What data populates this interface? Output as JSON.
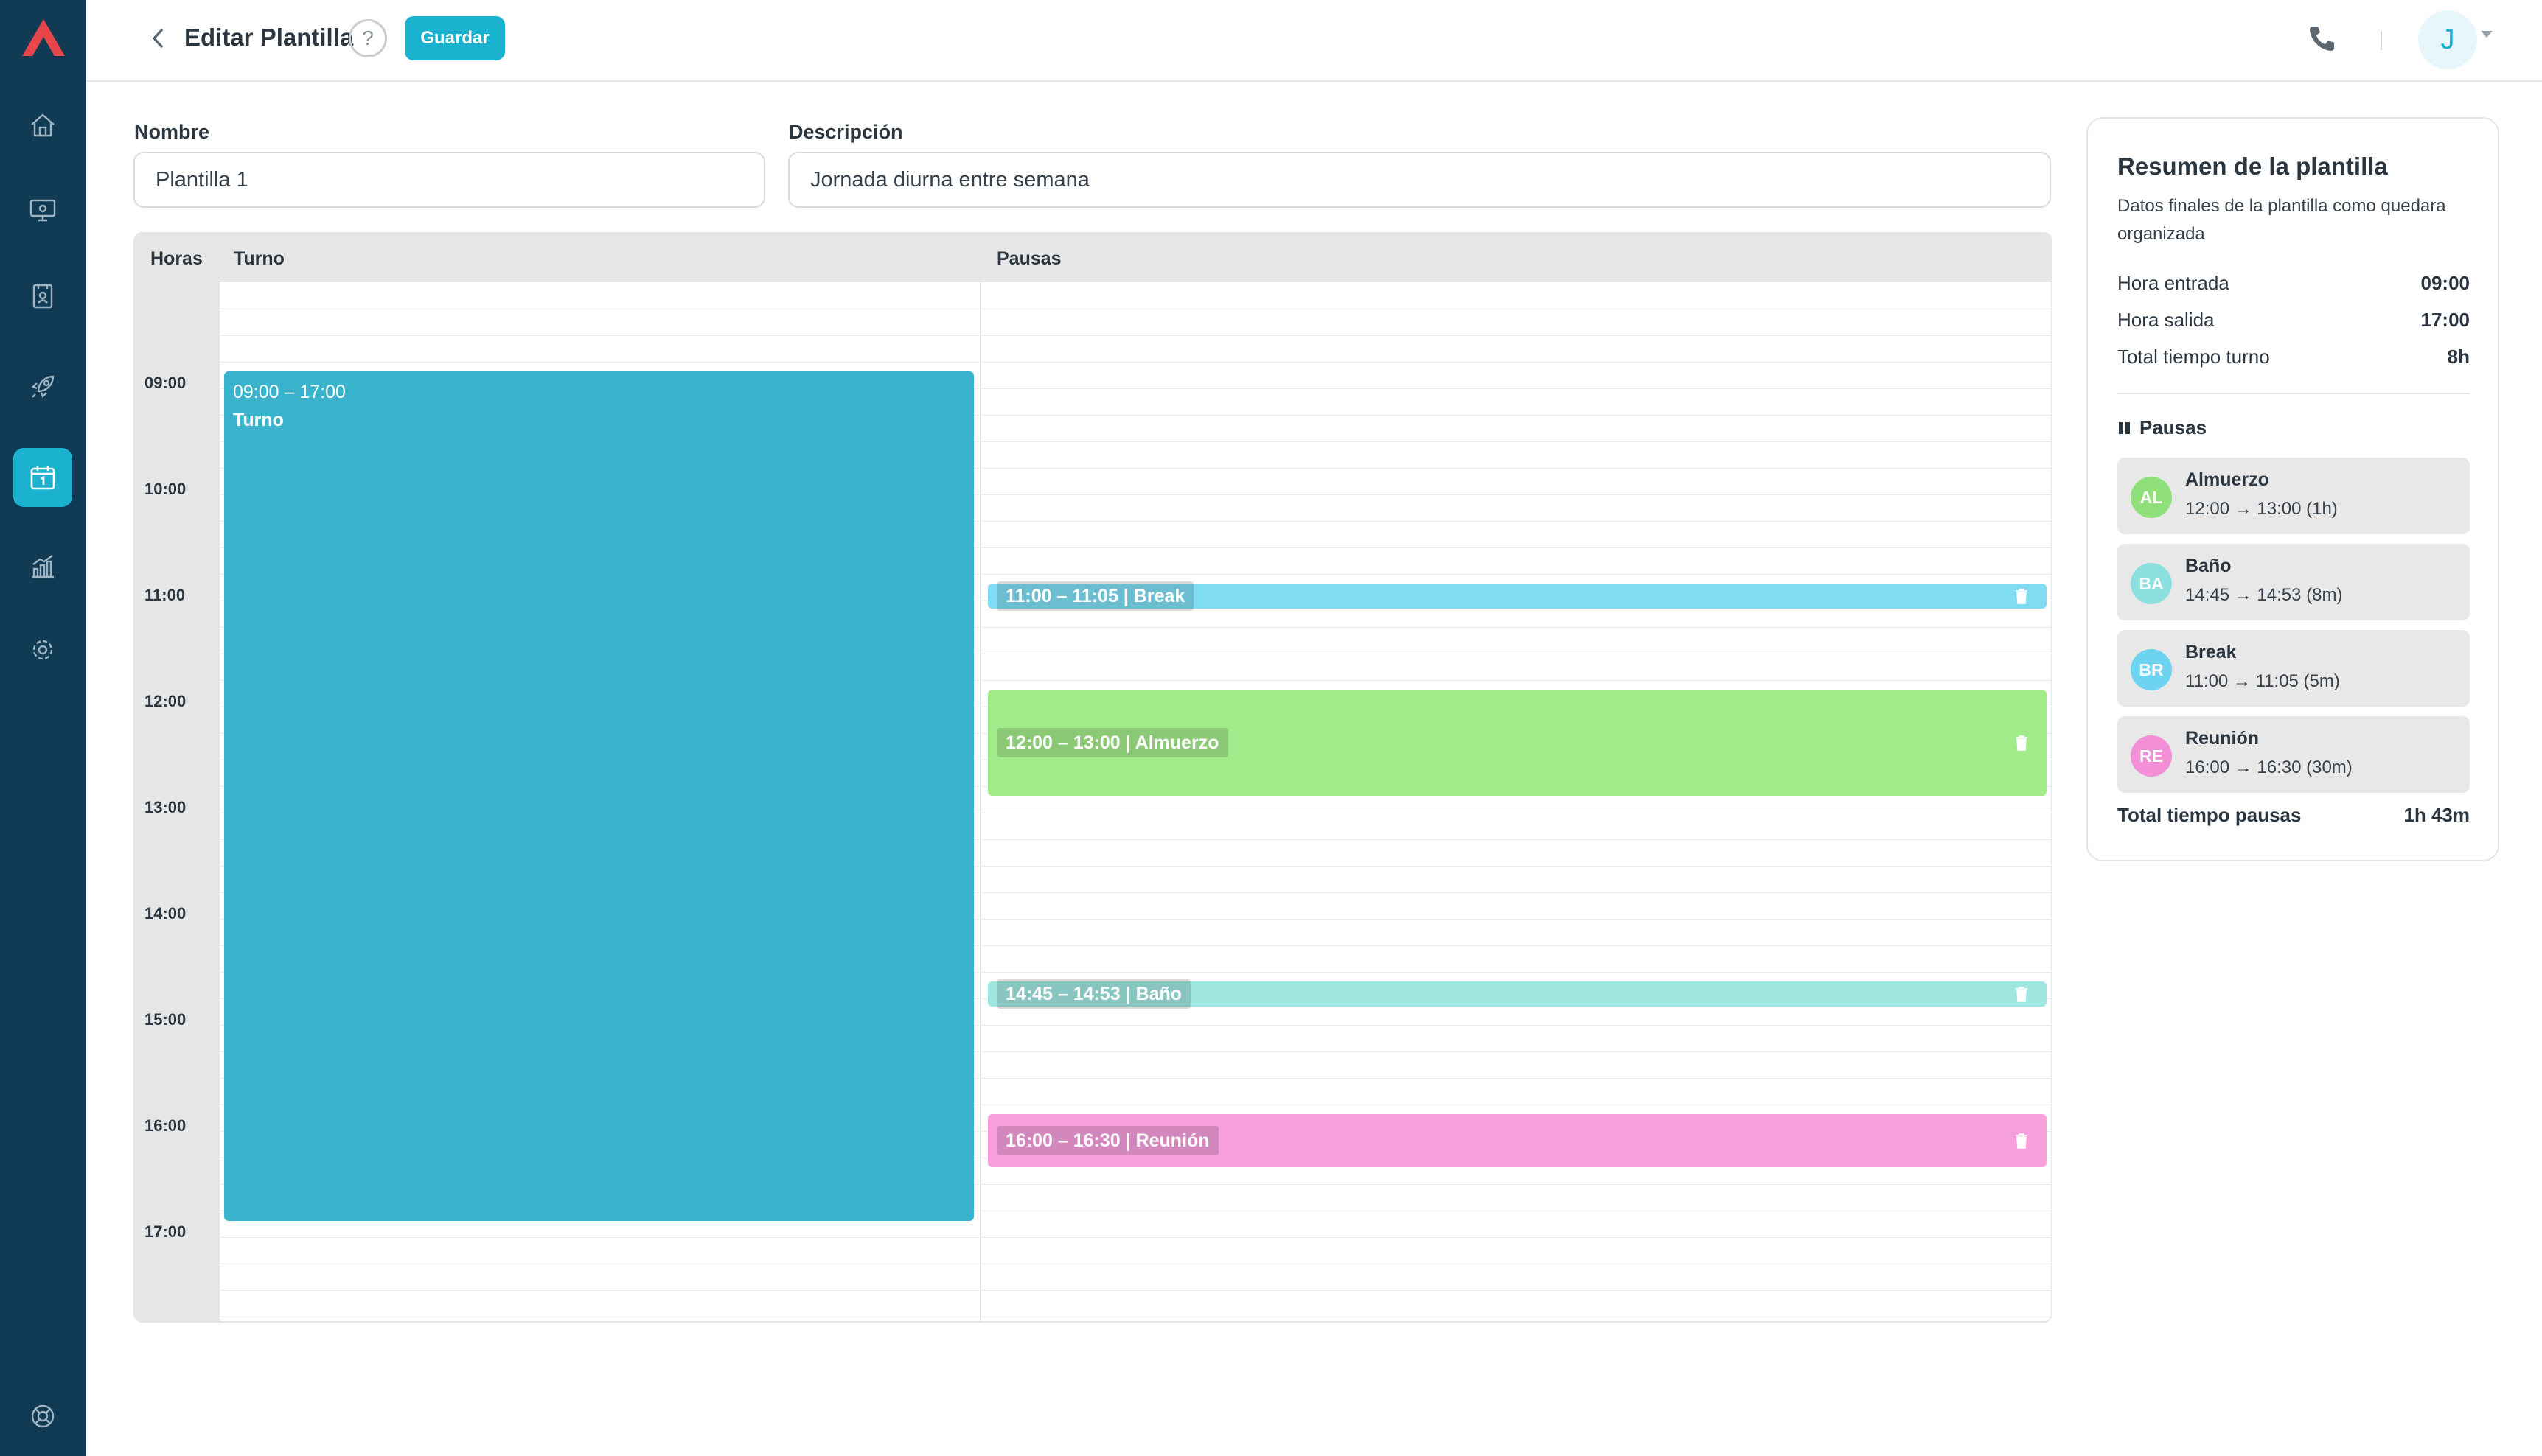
{
  "header": {
    "title": "Editar Plantilla",
    "help": "?",
    "save_label": "Guardar",
    "avatar_initial": "J"
  },
  "form": {
    "name_label": "Nombre",
    "name_value": "Plantilla 1",
    "description_label": "Descripción",
    "description_value": "Jornada diurna entre semana"
  },
  "grid": {
    "headers": {
      "hours": "Horas",
      "shift": "Turno",
      "pauses": "Pausas"
    },
    "hours": [
      "09:00",
      "10:00",
      "11:00",
      "12:00",
      "13:00",
      "14:00",
      "15:00",
      "16:00",
      "17:00"
    ],
    "shift": {
      "time": "09:00 – 17:00",
      "label": "Turno",
      "color": "#18a7c5"
    },
    "pauses": [
      {
        "label": "11:00 – 11:05 | Break",
        "color": "#7fdcf3"
      },
      {
        "label": "12:00 – 13:00 | Almuerzo",
        "color": "#a2eb8a"
      },
      {
        "label": "14:45 – 14:53 | Baño",
        "color": "#a0e6e0"
      },
      {
        "label": "16:00 – 16:30 | Reunión",
        "color": "#f69fdc"
      }
    ]
  },
  "summary": {
    "title": "Resumen de la plantilla",
    "subtitle": "Datos finales de la plantilla como quedara organizada",
    "rows": [
      {
        "key": "Hora entrada",
        "value": "09:00"
      },
      {
        "key": "Hora salida",
        "value": "17:00"
      },
      {
        "key": "Total tiempo turno",
        "value": "8h"
      }
    ],
    "pauses_heading": "Pausas",
    "pauses": [
      {
        "initials": "AL",
        "name": "Almuerzo",
        "time": "12:00 → 13:00 (1h)",
        "color": "#8fe07a"
      },
      {
        "initials": "BA",
        "name": "Baño",
        "time": "14:45 → 14:53 (8m)",
        "color": "#8cdfdf"
      },
      {
        "initials": "BR",
        "name": "Break",
        "time": "11:00 → 11:05 (5m)",
        "color": "#6cd3f0"
      },
      {
        "initials": "RE",
        "name": "Reunión",
        "time": "16:00 → 16:30 (30m)",
        "color": "#f38fd6"
      }
    ],
    "total_label": "Total tiempo pausas",
    "total_value": "1h 43m"
  },
  "colors": {
    "accent": "#1ab2cf",
    "sidebar": "#113b54",
    "brand_logo": "#e8464a"
  }
}
